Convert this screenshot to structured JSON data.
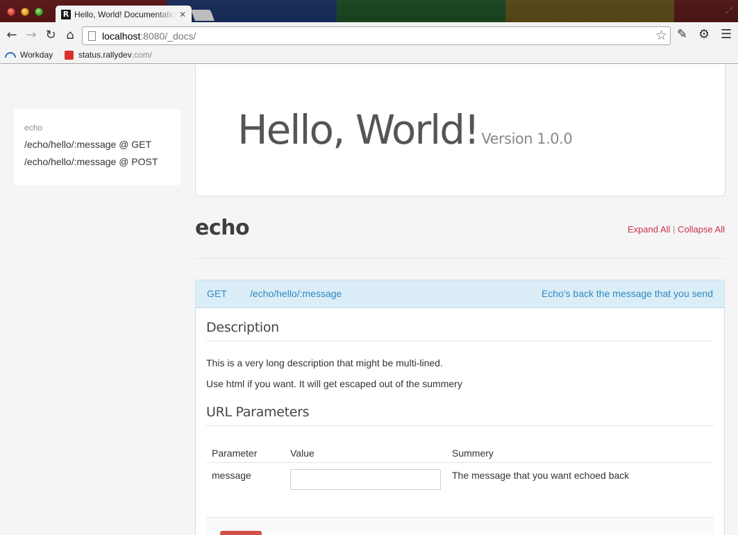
{
  "browser": {
    "tab_title": "Hello, World! Documentation",
    "url_host": "localhost",
    "url_rest": ":8080/_docs/",
    "theme_colors": [
      "#8b1a1a",
      "#1d3f8f",
      "#1f6b2a",
      "#8a6d1b",
      "#7a1a1a"
    ],
    "bookmarks": [
      {
        "label": "Workday"
      },
      {
        "label_host": "status.rallydev",
        "label_rest": ".com/"
      }
    ]
  },
  "sidebar": {
    "group": "echo",
    "links": [
      "/echo/hello/:message @ GET",
      "/echo/hello/:message @ POST"
    ]
  },
  "hero": {
    "title": "Hello, World!",
    "version": "Version 1.0.0"
  },
  "section": {
    "title": "echo",
    "expand_all": "Expand All",
    "separator": "|",
    "collapse_all": "Collapse All"
  },
  "endpoint": {
    "method": "GET",
    "path": "/echo/hello/:message",
    "summary": "Echo's back the message that you send",
    "description_heading": "Description",
    "description_lines": [
      "This is a very long description that might be multi-lined.",
      "Use html if you want. It will get escaped out of the summery"
    ],
    "params_heading": "URL Parameters",
    "params_columns": [
      "Parameter",
      "Value",
      "Summery"
    ],
    "params_rows": [
      {
        "name": "message",
        "value": "",
        "summary": "The message that you want echoed back"
      }
    ]
  },
  "colors": {
    "accent_link": "#c7334a",
    "endpoint_blue": "#2d8ac0",
    "endpoint_bg": "#dbedf7"
  }
}
